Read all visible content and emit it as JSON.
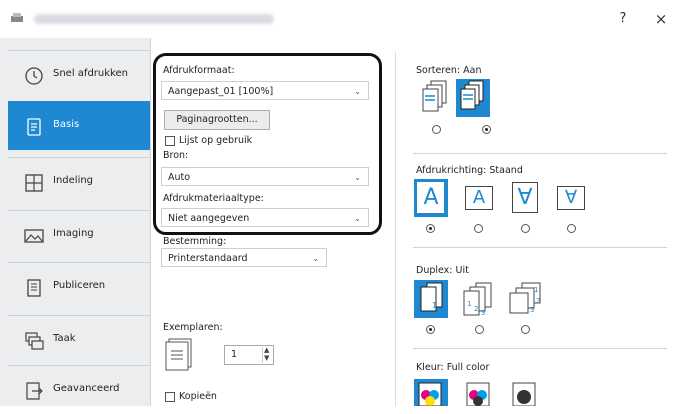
{
  "window": {
    "help": "?",
    "close": "×"
  },
  "sidebar": {
    "items": [
      {
        "label": "Snel afdrukken",
        "icon": "clock-icon"
      },
      {
        "label": "Basis",
        "icon": "document-icon",
        "active": true
      },
      {
        "label": "Indeling",
        "icon": "layout-grid-icon"
      },
      {
        "label": "Imaging",
        "icon": "image-icon"
      },
      {
        "label": "Publiceren",
        "icon": "booklet-icon"
      },
      {
        "label": "Taak",
        "icon": "job-stack-icon"
      },
      {
        "label": "Geavanceerd",
        "icon": "advanced-icon"
      }
    ]
  },
  "basic": {
    "print_format_label": "Afdrukformaat:",
    "print_format_value": "Aangepast_01 [100%]",
    "paper_sizes_button": "Paginagrootten...",
    "use_list_label": "Lijst op gebruik",
    "source_label": "Bron:",
    "source_value": "Auto",
    "media_type_label": "Afdrukmateriaaltype:",
    "media_type_value": "Niet aangegeven",
    "destination_label": "Bestemming:",
    "destination_value": "Printerstandaard",
    "copies_label": "Exemplaren:",
    "copies_value": "1",
    "collate_copies_label": "Kopieën"
  },
  "options": {
    "collate_label": "Sorteren:",
    "collate_value": "Aan",
    "orientation_label": "Afdrukrichting:",
    "orientation_value": "Staand",
    "orientation_glyphs": [
      "A",
      "A",
      "∀",
      "∀"
    ],
    "duplex_label": "Duplex:",
    "duplex_value": "Uit",
    "color_label": "Kleur:",
    "color_value": "Full color"
  },
  "colors": {
    "accent": "#1e88d2",
    "sidebar_bg": "#ecedef"
  }
}
